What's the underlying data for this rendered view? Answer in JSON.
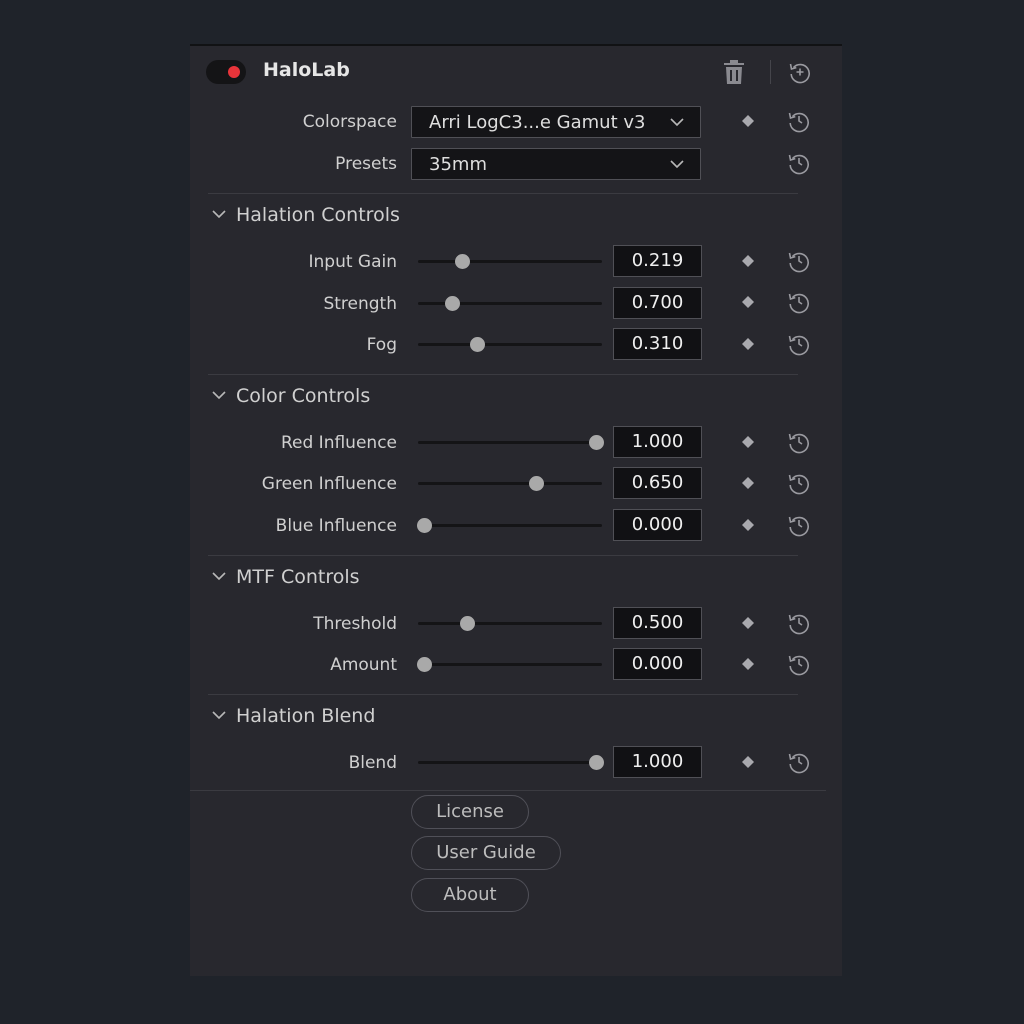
{
  "header": {
    "title": "HaloLab",
    "enabled": true
  },
  "colorspace": {
    "label": "Colorspace",
    "value": "Arri LogC3...e Gamut v3"
  },
  "presets": {
    "label": "Presets",
    "value": "35mm"
  },
  "sections": [
    {
      "title": "Halation Controls",
      "params": [
        {
          "label": "Input Gain",
          "value": "0.219",
          "level": 0.22
        },
        {
          "label": "Strength",
          "value": "0.700",
          "level": 0.16
        },
        {
          "label": "Fog",
          "value": "0.310",
          "level": 0.31
        }
      ]
    },
    {
      "title": "Color Controls",
      "params": [
        {
          "label": "Red Influence",
          "value": "1.000",
          "level": 1.0
        },
        {
          "label": "Green Influence",
          "value": "0.650",
          "level": 0.65
        },
        {
          "label": "Blue Influence",
          "value": "0.000",
          "level": 0.0
        }
      ]
    },
    {
      "title": "MTF Controls",
      "params": [
        {
          "label": "Threshold",
          "value": "0.500",
          "level": 0.25
        },
        {
          "label": "Amount",
          "value": "0.000",
          "level": 0.0
        }
      ]
    },
    {
      "title": "Halation Blend",
      "params": [
        {
          "label": "Blend",
          "value": "1.000",
          "level": 1.0
        }
      ]
    }
  ],
  "buttons": {
    "license": "License",
    "user_guide": "User Guide",
    "about": "About"
  },
  "colors": {
    "accent_red": "#e8343a",
    "panel_bg": "#28282e",
    "page_bg": "#1f232a"
  },
  "icons": {
    "trash": "trash-icon",
    "reset": "reset-icon",
    "keyframe": "keyframe-diamond-icon",
    "chevron": "chevron-down-icon"
  }
}
